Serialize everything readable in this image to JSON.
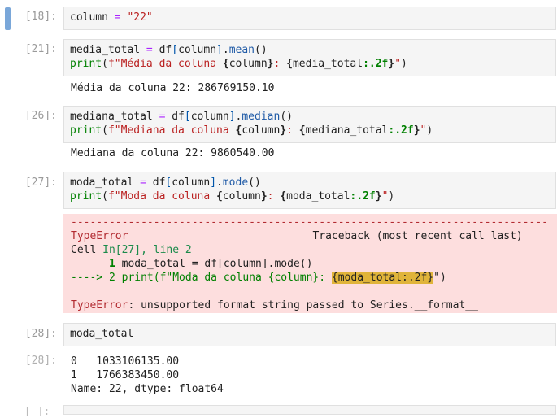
{
  "cells": [
    {
      "prompt": "[18]:",
      "code": [
        "column = \"22\""
      ]
    },
    {
      "prompt": "[21]:",
      "code": [
        "media_total = df[column].mean()",
        "print(f\"Média da coluna {column}: {media_total:.2f}\")"
      ],
      "output": "Média da coluna 22: 286769150.10"
    },
    {
      "prompt": "[26]:",
      "code": [
        "mediana_total = df[column].median()",
        "print(f\"Mediana da coluna {column}: {mediana_total:.2f}\")"
      ],
      "output": "Mediana da coluna 22: 9860540.00"
    },
    {
      "prompt": "[27]:",
      "code": [
        "moda_total = df[column].mode()",
        "print(f\"Moda da coluna {column}: {moda_total:.2f}\")"
      ]
    },
    {
      "prompt": "[28]:",
      "code": [
        "moda_total"
      ],
      "out_prompt": "[28]:",
      "output_lines": [
        "0   1033106135.00",
        "1   1766383450.00",
        "Name: 22, dtype: float64"
      ]
    }
  ],
  "error": {
    "dashes": "---------------------------------------------------------------------------",
    "type": "TypeError",
    "traceback_label": "Traceback (most recent call last)",
    "cell_prefix": "Cell ",
    "cell_ref": "In[27], line 2",
    "line1_no": "1",
    "line1_code": " moda_total = df[column].mode()",
    "arrow_prefix": "----> 2 print(f\"Moda da coluna {column}: ",
    "highlight": "{moda_total:.2f}",
    "arrow_suffix": "\")",
    "message": ": unsupported format string passed to Series.__format__"
  },
  "bottom_prompt": "[ ]:"
}
